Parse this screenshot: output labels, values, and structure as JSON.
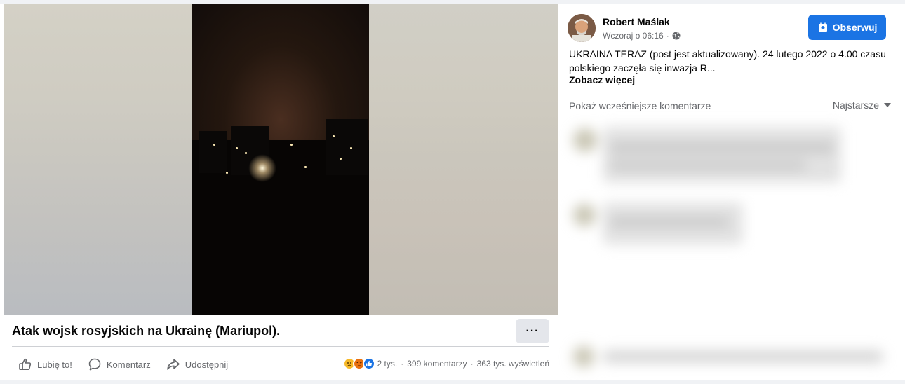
{
  "video": {
    "title": "Atak wojsk rosyjskich na Ukrainę (Mariupol).",
    "more_label": "···"
  },
  "actions": {
    "like": "Lubię to!",
    "comment": "Komentarz",
    "share": "Udostępnij"
  },
  "stats": {
    "reactions": "2 tys.",
    "comments": "399 komentarzy",
    "views": "363 tys. wyświetleń",
    "separator": "·"
  },
  "post": {
    "author": "Robert Maślak",
    "time": "Wczoraj o 06:16",
    "meta_dot": "·",
    "follow_label": "Obserwuj",
    "text": "UKRAINA TERAZ (post jest aktualizowany). 24 lutego 2022 o 4.00 czasu polskiego zaczęła się inwazja R...",
    "see_more": "Zobacz więcej"
  },
  "comments": {
    "show_earlier": "Pokaż wcześniejsze komentarze",
    "sort_label": "Najstarsze"
  },
  "colors": {
    "accent": "#1b74e4",
    "muted_text": "#65676b",
    "divider": "#ced0d4"
  },
  "icons": [
    "thumbs-up-icon",
    "comment-icon",
    "share-icon",
    "globe-icon",
    "follow-icon",
    "caret-down-icon",
    "reaction-sad-icon",
    "reaction-angry-icon",
    "reaction-like-icon",
    "more-dots-icon"
  ]
}
